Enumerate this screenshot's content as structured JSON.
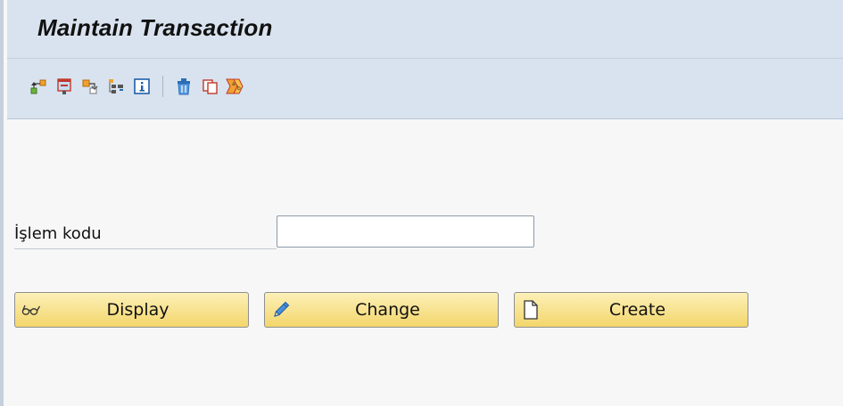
{
  "window": {
    "title": "Maintain Transaction"
  },
  "toolbar": {
    "icons": [
      "hierarchy-up-icon",
      "display-object-icon",
      "where-used-icon",
      "structure-icon",
      "info-icon",
      "delete-icon",
      "copy-icon",
      "rename-icon"
    ]
  },
  "form": {
    "transaction_code_label": "İşlem kodu",
    "transaction_code_value": "",
    "transaction_code_placeholder": ""
  },
  "buttons": {
    "display_label": "Display",
    "change_label": "Change",
    "create_label": "Create",
    "display_icon": "glasses-icon",
    "change_icon": "pencil-icon",
    "create_icon": "blank-page-icon"
  },
  "colors": {
    "header_bg": "#d9e3ef",
    "content_bg": "#f7f7f8",
    "button_gradient_top": "#fcf0b8",
    "button_gradient_bottom": "#f3d66a"
  }
}
